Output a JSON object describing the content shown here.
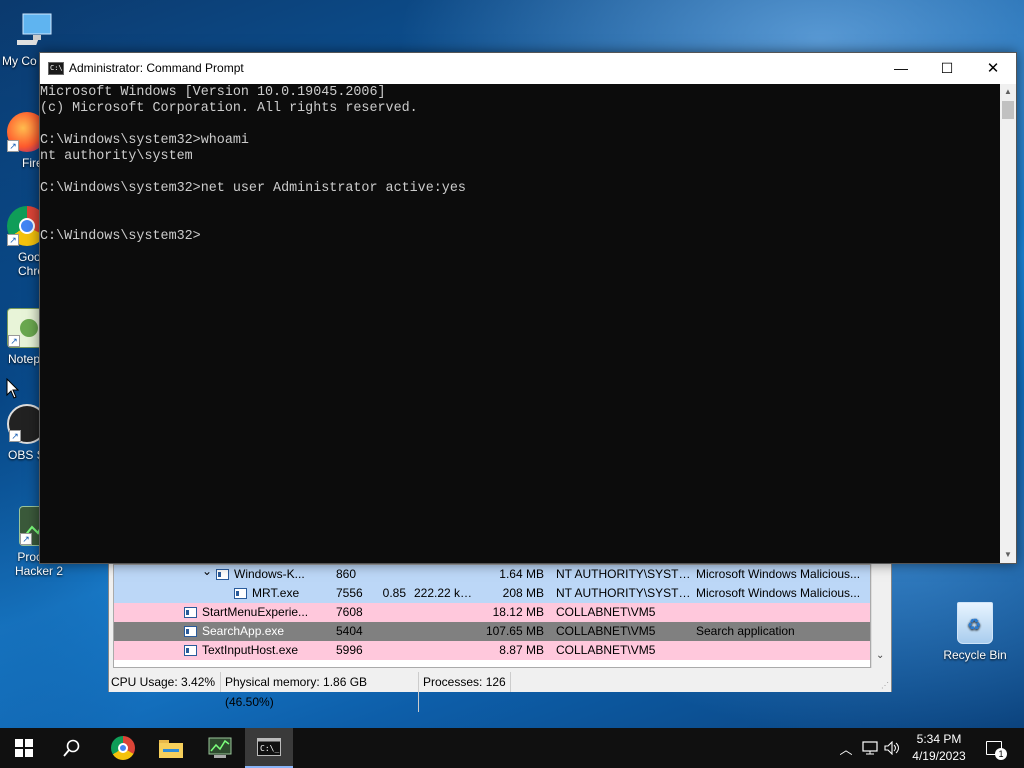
{
  "desktop": {
    "icons": [
      {
        "label": "My Co",
        "icon": "computer-icon"
      },
      {
        "label": "Fire",
        "icon": "firefox-icon"
      },
      {
        "label": "Goo\nChro",
        "icon": "chrome-icon"
      },
      {
        "label": "Notep",
        "icon": "notepad-icon"
      },
      {
        "label": "OBS S",
        "icon": "obs-icon"
      },
      {
        "label": "Process\nHacker 2",
        "icon": "process-hacker-icon"
      },
      {
        "label": "Recycle Bin",
        "icon": "recycle-bin-icon"
      }
    ]
  },
  "cmd": {
    "title": "Administrator: Command Prompt",
    "icon_text": "C:\\",
    "lines": [
      "Microsoft Windows [Version 10.0.19045.2006]",
      "(c) Microsoft Corporation. All rights reserved.",
      "",
      "C:\\Windows\\system32>whoami",
      "nt authority\\system",
      "",
      "C:\\Windows\\system32>net user Administrator active:yes",
      "",
      "",
      "C:\\Windows\\system32>"
    ],
    "buttons": {
      "minimize": "—",
      "maximize": "☐",
      "close": "✕"
    }
  },
  "process_hacker": {
    "rows": [
      {
        "name": "Windows-K...",
        "pid": "860",
        "cpu": "",
        "io": "",
        "mem": "1.64 MB",
        "user": "NT AUTHORITY\\SYSTEM",
        "desc": "Microsoft Windows Malicious...",
        "color": "#bcd7f7",
        "indent": 2,
        "expander": "⌄"
      },
      {
        "name": "MRT.exe",
        "pid": "7556",
        "cpu": "0.85",
        "io": "222.22 kB...",
        "mem": "208 MB",
        "user": "NT AUTHORITY\\SYSTEM",
        "desc": "Microsoft Windows Malicious...",
        "color": "#bcd7f7",
        "indent": 3,
        "expander": ""
      },
      {
        "name": "StartMenuExperie...",
        "pid": "7608",
        "cpu": "",
        "io": "",
        "mem": "18.12 MB",
        "user": "COLLABNET\\VM5",
        "desc": "",
        "color": "#ffc8dc",
        "indent": 1,
        "expander": ""
      },
      {
        "name": "SearchApp.exe",
        "pid": "5404",
        "cpu": "",
        "io": "",
        "mem": "107.65 MB",
        "user": "COLLABNET\\VM5",
        "desc": "Search application",
        "color": "#808080",
        "indent": 1,
        "expander": ""
      },
      {
        "name": "TextInputHost.exe",
        "pid": "5996",
        "cpu": "",
        "io": "",
        "mem": "8.87 MB",
        "user": "COLLABNET\\VM5",
        "desc": "",
        "color": "#ffc8dc",
        "indent": 1,
        "expander": ""
      }
    ],
    "status": {
      "cpu": "CPU Usage: 3.42%",
      "memory": "Physical memory: 1.86 GB (46.50%)",
      "processes": "Processes: 126"
    }
  },
  "taskbar": {
    "items": [
      {
        "name": "start-button",
        "icon": "windows-logo-icon"
      },
      {
        "name": "search-button",
        "icon": "search-icon"
      },
      {
        "name": "chrome-taskbar",
        "icon": "chrome-icon"
      },
      {
        "name": "file-explorer-taskbar",
        "icon": "folder-icon"
      },
      {
        "name": "process-hacker-taskbar",
        "icon": "process-hacker-icon"
      },
      {
        "name": "cmd-taskbar",
        "icon": "cmd-icon",
        "active": true
      }
    ],
    "clock": {
      "time": "5:34 PM",
      "date": "4/19/2023"
    },
    "notification_count": "1"
  }
}
